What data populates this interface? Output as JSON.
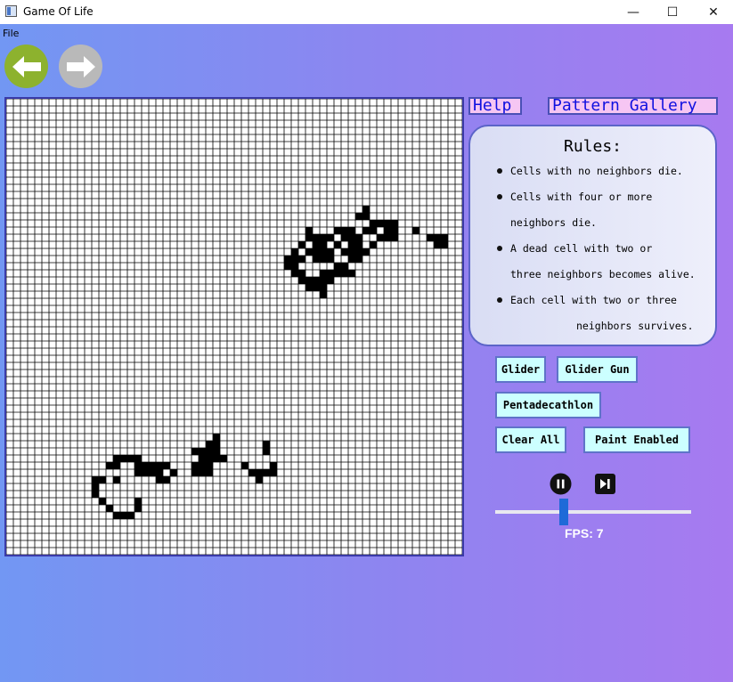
{
  "window": {
    "title": "Game Of Life",
    "minimize_glyph": "—",
    "maximize_glyph": "☐",
    "close_glyph": "✕"
  },
  "menu": {
    "file_label": "File"
  },
  "nav": {
    "back_icon": "arrow-left-icon",
    "forward_icon": "arrow-right-icon",
    "back_color": "#8db22e",
    "forward_color": "#b9b9b9"
  },
  "links": {
    "help_label": "Help",
    "gallery_label": "Pattern Gallery"
  },
  "rules": {
    "title": "Rules:",
    "lines": [
      "Cells with no neighbors die.",
      "Cells with four or more",
      "neighbors die.",
      "A dead cell with two or",
      "three neighbors becomes alive.",
      "Each cell with two or three",
      "neighbors survives."
    ]
  },
  "patterns": {
    "glider": "Glider",
    "glider_gun": "Glider Gun",
    "pentadecathlon": "Pentadecathlon",
    "clear_all": "Clear All",
    "paint_enabled": "Paint Enabled"
  },
  "playback": {
    "pause_icon": "pause-icon",
    "step_icon": "step-forward-icon",
    "fps_label": "FPS: 7",
    "fps_value": 7,
    "fps_slider_fraction": 0.35
  },
  "colors": {
    "grid_border": "#3a3aa8",
    "link_bg": "#f6c6f3",
    "link_text": "#1010e0",
    "pattern_bg": "#ccffff",
    "alive": "#000000",
    "slider_thumb": "#1e6ad8"
  },
  "board": {
    "columns": 64,
    "rows": 64,
    "alive_cells": [
      [
        20,
        55
      ],
      [
        21,
        55
      ],
      [
        21,
        54
      ],
      [
        22,
        54
      ],
      [
        22,
        53
      ],
      [
        22,
        55
      ],
      [
        22,
        57
      ],
      [
        23,
        53
      ],
      [
        23,
        55
      ],
      [
        23,
        56
      ],
      [
        24,
        52
      ],
      [
        24,
        54
      ],
      [
        25,
        52
      ],
      [
        25,
        51
      ],
      [
        25,
        53
      ],
      [
        26,
        49
      ],
      [
        26,
        50
      ],
      [
        26,
        52
      ],
      [
        27,
        49
      ],
      [
        27,
        48
      ],
      [
        27,
        51
      ],
      [
        28,
        48
      ],
      [
        28,
        49
      ],
      [
        28,
        50
      ],
      [
        28,
        51
      ],
      [
        29,
        48
      ],
      [
        29,
        51
      ],
      [
        30,
        47
      ],
      [
        30,
        48
      ],
      [
        30,
        52
      ],
      [
        31,
        47
      ],
      [
        31,
        49
      ],
      [
        31,
        52
      ],
      [
        32,
        46
      ],
      [
        32,
        49
      ],
      [
        33,
        46
      ],
      [
        33,
        49
      ],
      [
        33,
        50
      ],
      [
        34,
        46
      ],
      [
        34,
        48
      ],
      [
        34,
        51
      ],
      [
        35,
        45
      ],
      [
        35,
        47
      ],
      [
        36,
        44
      ],
      [
        36,
        45
      ],
      [
        37,
        42
      ],
      [
        37,
        43
      ],
      [
        37,
        44
      ],
      [
        37,
        45
      ],
      [
        38,
        40
      ],
      [
        38,
        41
      ],
      [
        38,
        42
      ],
      [
        39,
        41
      ],
      [
        39,
        42
      ],
      [
        40,
        41
      ],
      [
        40,
        42
      ],
      [
        41,
        42
      ],
      [
        41,
        43
      ],
      [
        42,
        43
      ],
      [
        42,
        44
      ],
      [
        43,
        44
      ],
      [
        39,
        59
      ],
      [
        39,
        60
      ],
      [
        40,
        59
      ],
      [
        40,
        60
      ],
      [
        40,
        61
      ],
      [
        41,
        62
      ],
      [
        40,
        63
      ],
      [
        39,
        63
      ],
      [
        47,
        44
      ],
      [
        47,
        45
      ],
      [
        46,
        46
      ],
      [
        46,
        47
      ],
      [
        46,
        48
      ],
      [
        45,
        48
      ],
      [
        45,
        49
      ],
      [
        44,
        49
      ],
      [
        44,
        50
      ],
      [
        56,
        45
      ],
      [
        56,
        46
      ],
      [
        57,
        45
      ],
      [
        58,
        45
      ],
      [
        58,
        44
      ],
      [
        59,
        44
      ],
      [
        59,
        43
      ],
      [
        60,
        42
      ],
      [
        60,
        43
      ],
      [
        61,
        42
      ],
      [
        61,
        41
      ],
      [
        62,
        41
      ],
      [
        62,
        40
      ],
      [
        63,
        40
      ],
      [
        63,
        39
      ],
      [
        27,
        49
      ],
      [
        29,
        49
      ]
    ],
    "alive_cells_lower": [
      [
        16,
        46
      ],
      [
        16,
        47
      ],
      [
        17,
        46
      ],
      [
        17,
        47
      ],
      [
        18,
        45
      ],
      [
        18,
        46
      ],
      [
        18,
        47
      ],
      [
        18,
        48
      ],
      [
        19,
        46
      ],
      [
        19,
        48
      ],
      [
        20,
        47
      ],
      [
        20,
        48
      ],
      [
        21,
        48
      ],
      [
        22,
        49
      ],
      [
        23,
        49
      ],
      [
        23,
        50
      ],
      [
        24,
        50
      ],
      [
        13,
        48
      ],
      [
        13,
        49
      ],
      [
        14,
        47
      ],
      [
        14,
        48
      ],
      [
        15,
        47
      ],
      [
        15,
        52
      ],
      [
        16,
        52
      ],
      [
        16,
        51
      ],
      [
        17,
        51
      ],
      [
        12,
        53
      ],
      [
        12,
        54
      ],
      [
        13,
        54
      ],
      [
        14,
        55
      ],
      [
        15,
        56
      ],
      [
        16,
        56
      ],
      [
        17,
        56
      ],
      [
        18,
        55
      ],
      [
        18,
        54
      ],
      [
        17,
        53
      ],
      [
        13,
        55
      ],
      [
        19,
        52
      ],
      [
        20,
        51
      ],
      [
        20,
        52
      ],
      [
        21,
        52
      ],
      [
        22,
        52
      ],
      [
        26,
        49
      ],
      [
        26,
        50
      ],
      [
        27,
        49
      ],
      [
        27,
        50
      ],
      [
        27,
        51
      ],
      [
        28,
        48
      ],
      [
        28,
        49
      ],
      [
        29,
        47
      ],
      [
        29,
        48
      ],
      [
        30,
        46
      ],
      [
        30,
        47
      ],
      [
        30,
        48
      ],
      [
        28,
        47
      ],
      [
        27,
        48
      ],
      [
        26,
        51
      ],
      [
        25,
        50
      ],
      [
        32,
        51
      ],
      [
        33,
        51
      ],
      [
        33,
        52
      ],
      [
        34,
        52
      ],
      [
        34,
        53
      ],
      [
        35,
        51
      ],
      [
        35,
        50
      ],
      [
        36,
        49
      ],
      [
        36,
        50
      ],
      [
        35,
        53
      ]
    ]
  }
}
